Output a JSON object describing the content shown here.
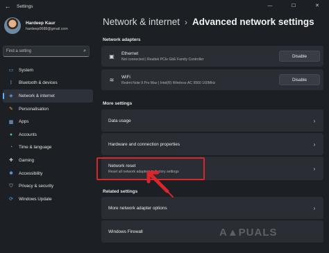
{
  "window": {
    "title": "Settings",
    "back_glyph": "←",
    "minimize_glyph": "—",
    "maximize_glyph": "☐",
    "close_glyph": "✕"
  },
  "profile": {
    "name": "Hardeep Kaur",
    "email": "hardeep0688@gmail.com"
  },
  "search": {
    "placeholder": "Find a setting",
    "icon": "search-icon",
    "glyph": "⌕"
  },
  "nav": [
    {
      "label": "System",
      "icon": "monitor-icon",
      "glyph": "▭",
      "color": "#5aa8e8"
    },
    {
      "label": "Bluetooth & devices",
      "icon": "bluetooth-icon",
      "glyph": "ᛒ",
      "color": "#5aa8e8"
    },
    {
      "label": "Network & internet",
      "icon": "wifi-icon",
      "glyph": "◈",
      "color": "#5aa8e8",
      "active": true
    },
    {
      "label": "Personalisation",
      "icon": "brush-icon",
      "glyph": "✎",
      "color": "#e0a155"
    },
    {
      "label": "Apps",
      "icon": "apps-icon",
      "glyph": "▦",
      "color": "#8ab4e8"
    },
    {
      "label": "Accounts",
      "icon": "person-icon",
      "glyph": "●",
      "color": "#4fc38c"
    },
    {
      "label": "Time & language",
      "icon": "globe-clock-icon",
      "glyph": "◔",
      "color": "#5aa8e8"
    },
    {
      "label": "Gaming",
      "icon": "gamepad-icon",
      "glyph": "✚",
      "color": "#c8c8c8"
    },
    {
      "label": "Accessibility",
      "icon": "accessibility-icon",
      "glyph": "✱",
      "color": "#5aa8e8"
    },
    {
      "label": "Privacy & security",
      "icon": "shield-icon",
      "glyph": "⛉",
      "color": "#b8b8b8"
    },
    {
      "label": "Windows Update",
      "icon": "update-icon",
      "glyph": "⟳",
      "color": "#5aa8e8"
    }
  ],
  "header": {
    "parent": "Network & internet",
    "separator": "›",
    "current": "Advanced network settings"
  },
  "sections": {
    "adapters": "Network adapters",
    "more": "More settings",
    "related": "Related settings"
  },
  "adapters": [
    {
      "name": "Ethernet",
      "detail": "Not connected | Realtek PCIe GbE Family Controller",
      "button": "Disable",
      "icon": "ethernet-icon",
      "glyph": "▣"
    },
    {
      "name": "WiFi",
      "detail": "Redmi Note 9 Pro Max | Intel(R) Wireless-AC 9560 160MHz",
      "button": "Disable",
      "icon": "wifi-icon",
      "glyph": "≋"
    }
  ],
  "more_settings": [
    {
      "label": "Data usage"
    },
    {
      "label": "Hardware and connection properties"
    },
    {
      "label": "Network reset",
      "detail": "Reset all network adapters to factory settings"
    }
  ],
  "related_settings": [
    {
      "label": "More network adapter options"
    },
    {
      "label": "Windows Firewall"
    }
  ],
  "chevron": "›",
  "annotation": {
    "color": "#d9262b"
  },
  "watermark": "A▲PUALS",
  "accent": "#5eb4ff"
}
